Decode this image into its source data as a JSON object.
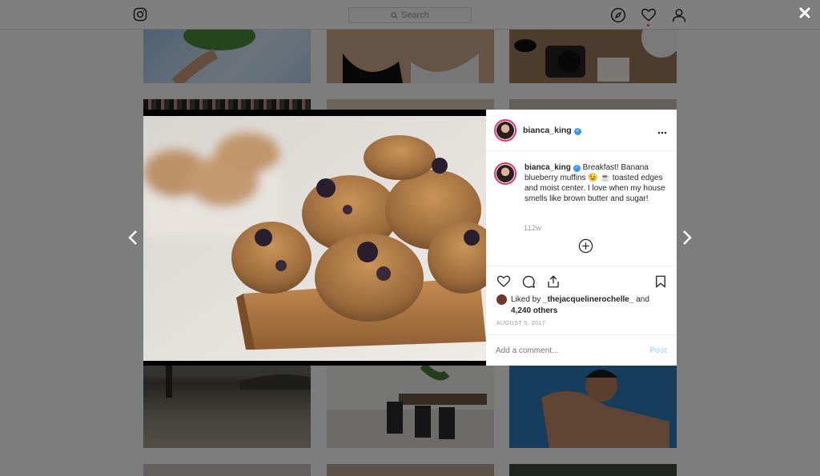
{
  "topbar": {
    "search_placeholder": "Search",
    "logo_icon": "instagram-icon",
    "nav_icons": [
      "compass-icon",
      "heart-icon",
      "profile-icon"
    ]
  },
  "modal": {
    "close_icon": "close-icon",
    "prev_icon": "chevron-left-icon",
    "next_icon": "chevron-right-icon",
    "post": {
      "username": "bianca_king",
      "verified": true,
      "more_icon": "more-options-icon",
      "caption": "Breakfast! Banana blueberry muffins 😉 ☕ toasted edges and moist center. I love when my house smells like brown butter and sugar!",
      "time_ago": "112w",
      "load_more_icon": "plus-circle-icon",
      "liked_by_prefix": "Liked by",
      "liked_by_user": "_thejacquelinerochelle_",
      "liked_by_and": "and",
      "liked_count": "4,240 others",
      "date": "AUGUST 5, 2017",
      "comment_placeholder": "Add a comment...",
      "post_label": "Post",
      "action_icons": [
        "heart-icon",
        "comment-icon",
        "share-icon",
        "bookmark-icon"
      ]
    }
  },
  "colors": {
    "accent": "#3897f0",
    "story_ring": "#e1306c",
    "post_disabled": "#b2dffc"
  }
}
